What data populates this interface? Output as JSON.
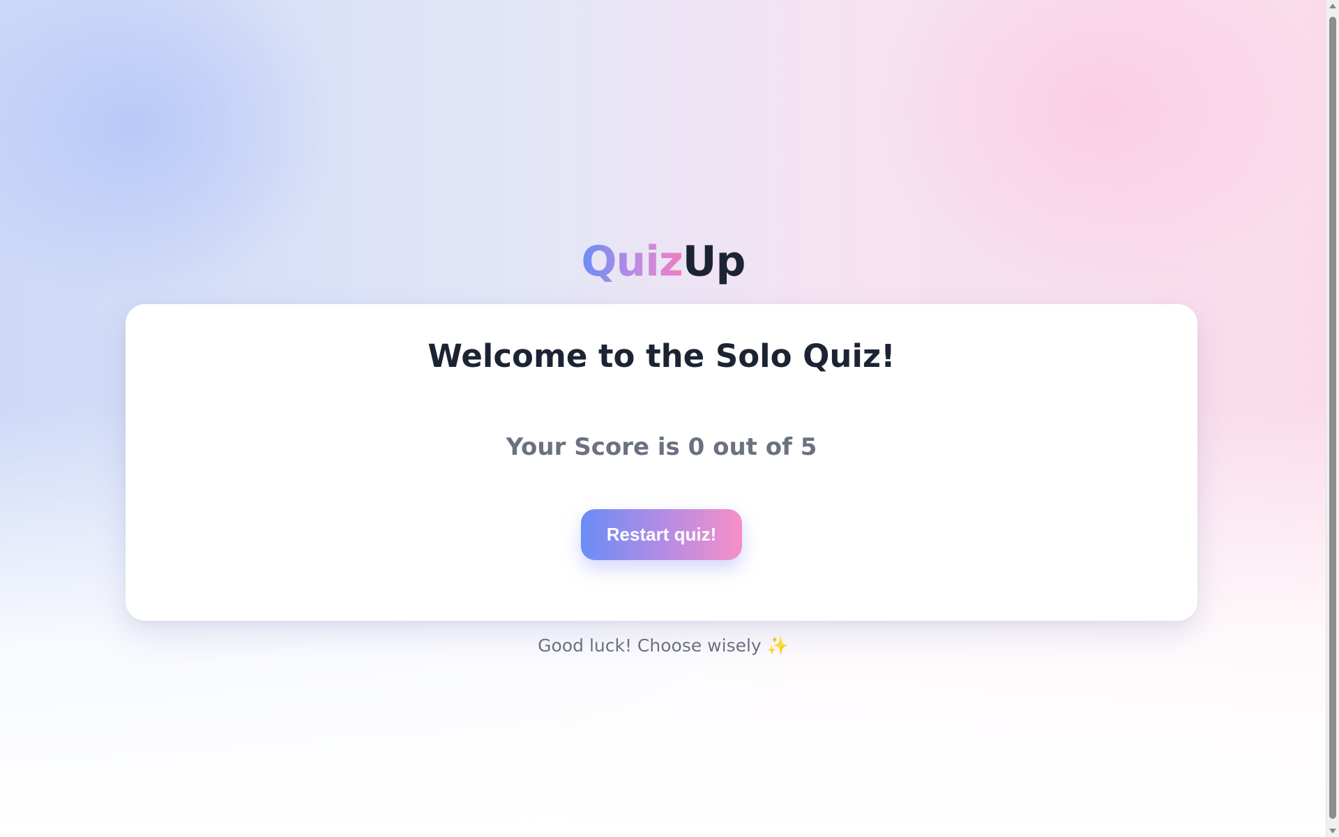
{
  "logo": {
    "part1": "Quiz",
    "part2": "Up"
  },
  "card": {
    "title": "Welcome to the Solo Quiz!",
    "score_text": "Your Score is 0 out of 5",
    "restart_label": "Restart quiz!"
  },
  "score": {
    "value": 0,
    "total": 5
  },
  "footer": {
    "note": "Good luck! Choose wisely",
    "emoji": "✨"
  },
  "colors": {
    "gradient_start": "#6b8cf6",
    "gradient_end": "#f78fc8",
    "heading": "#1c2434",
    "muted": "#6b7180"
  },
  "icons": {
    "footer": "sparkles-icon",
    "scroll_up": "scroll-up-arrow-icon",
    "scroll_down": "scroll-down-arrow-icon"
  }
}
